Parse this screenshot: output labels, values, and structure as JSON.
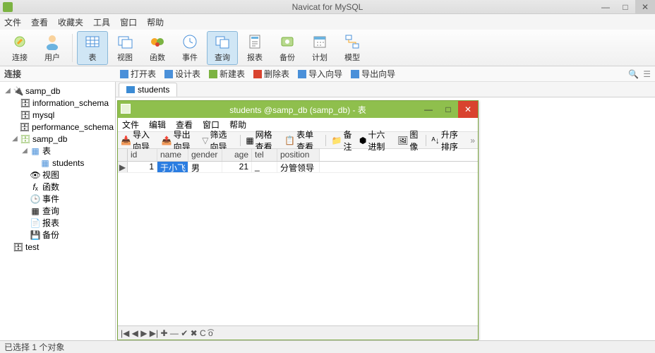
{
  "app": {
    "title": "Navicat for MySQL"
  },
  "menu": {
    "file": "文件",
    "view": "查看",
    "fav": "收藏夹",
    "tools": "工具",
    "window": "窗口",
    "help": "帮助"
  },
  "ribbon": {
    "connect": "连接",
    "user": "用户",
    "table": "表",
    "view": "视图",
    "func": "函数",
    "event": "事件",
    "query": "查询",
    "report": "报表",
    "backup": "备份",
    "schedule": "计划",
    "model": "模型"
  },
  "subrow": {
    "label": "连接",
    "open": "打开表",
    "design": "设计表",
    "new": "新建表",
    "delete": "删除表",
    "import": "导入向导",
    "export": "导出向导"
  },
  "tree": {
    "root": "samp_db",
    "info_schema": "information_schema",
    "mysql": "mysql",
    "perf": "performance_schema",
    "samp": "samp_db",
    "table_node": "表",
    "students": "students",
    "view_node": "视图",
    "func_node": "函数",
    "event_node": "事件",
    "query_node": "查询",
    "report_node": "报表",
    "backup_node": "备份",
    "test": "test"
  },
  "tab": {
    "label": "students"
  },
  "child": {
    "title": "students @samp_db (samp_db) - 表",
    "menu": {
      "file": "文件",
      "edit": "编辑",
      "view": "查看",
      "window": "窗口",
      "help": "帮助"
    },
    "toolbar": {
      "import": "导入向导",
      "export": "导出向导",
      "filter": "筛选向导",
      "gridview": "网格查看",
      "formview": "表单查看",
      "memo": "备注",
      "hex": "十六进制",
      "image": "图像",
      "sort": "升序排序"
    },
    "cols": {
      "id": "id",
      "name": "name",
      "gender": "gender",
      "age": "age",
      "tel": "tel",
      "position": "position"
    },
    "row": {
      "id": "1",
      "name": "于小飞",
      "gender": "男",
      "age": "21",
      "tel": "_",
      "position": "分管领导"
    },
    "nav": "|◀ ◀ ▶ ▶|  ✚ — ✔ ✖   C  ͡o"
  },
  "status": {
    "text": "已选择 1 个对象"
  }
}
